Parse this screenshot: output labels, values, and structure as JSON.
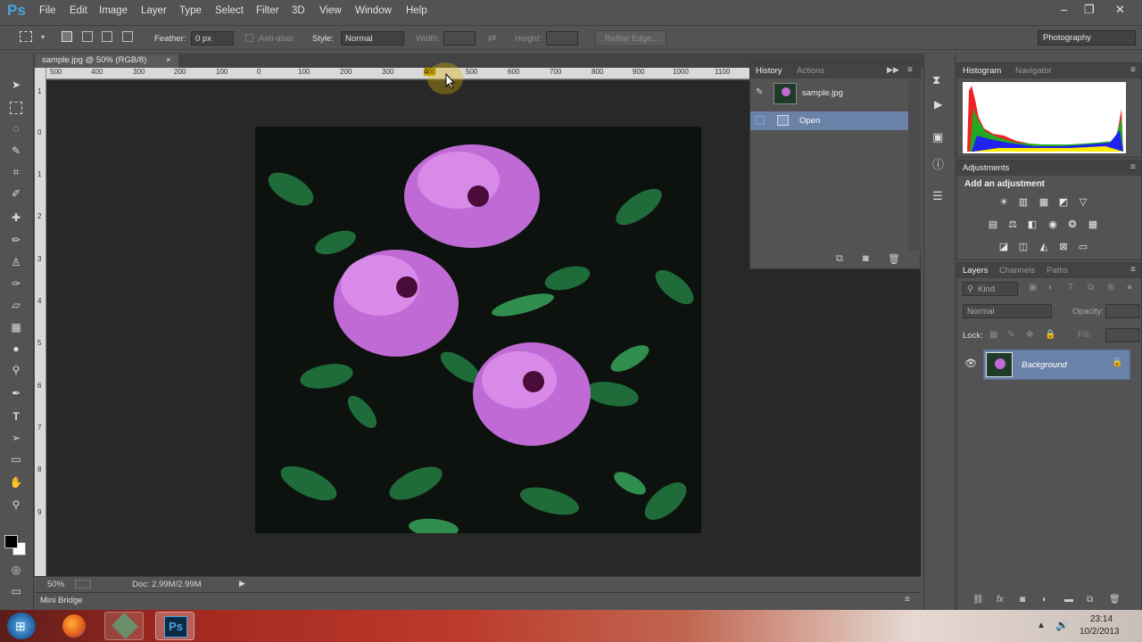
{
  "app": {
    "logo": "Ps",
    "menus": [
      "File",
      "Edit",
      "Image",
      "Layer",
      "Type",
      "Select",
      "Filter",
      "3D",
      "View",
      "Window",
      "Help"
    ],
    "window_controls": [
      "–",
      "❐",
      "✕"
    ]
  },
  "options": {
    "feather_label": "Feather:",
    "feather_value": "0 px",
    "antialias_label": "Anti-alias",
    "style_label": "Style:",
    "style_value": "Normal",
    "width_label": "Width:",
    "height_label": "Height:",
    "refine_edge": "Refine Edge...",
    "workspace": "Photography"
  },
  "document": {
    "tab_title": "sample.jpg @ 50% (RGB/8)",
    "tab_close": "×",
    "zoom": "50%",
    "doc_size": "Doc: 2.99M/2.99M"
  },
  "rulers": {
    "h_ticks": [
      "500",
      "400",
      "300",
      "200",
      "100",
      "0",
      "100",
      "200",
      "300",
      "400",
      "500",
      "600",
      "700",
      "800",
      "900",
      "1000",
      "1100"
    ],
    "v_ticks": [
      "1",
      "0",
      "1",
      "2",
      "3",
      "4",
      "5",
      "6",
      "7",
      "8",
      "9"
    ]
  },
  "mini_bridge": "Mini Bridge",
  "history_panel": {
    "tabs": [
      "History",
      "Actions"
    ],
    "snapshot": "sample.jpg",
    "states": [
      "Open"
    ]
  },
  "histogram_panel": {
    "tabs": [
      "Histogram",
      "Navigator"
    ],
    "warning": "⚠"
  },
  "adjustments_panel": {
    "title": "Adjustments",
    "subtitle": "Add an adjustment"
  },
  "layers_panel": {
    "tabs": [
      "Layers",
      "Channels",
      "Paths"
    ],
    "kind": "Kind",
    "blend": "Normal",
    "opacity_label": "Opacity:",
    "lock_label": "Lock:",
    "fill_label": "Fill:",
    "layers": [
      {
        "name": "Background"
      }
    ]
  },
  "taskbar": {
    "time": "23:14",
    "date": "10/2/2013"
  },
  "colors": {
    "accent": "#4aa2e0",
    "selection": "#6a82a8",
    "panel": "#535353"
  }
}
